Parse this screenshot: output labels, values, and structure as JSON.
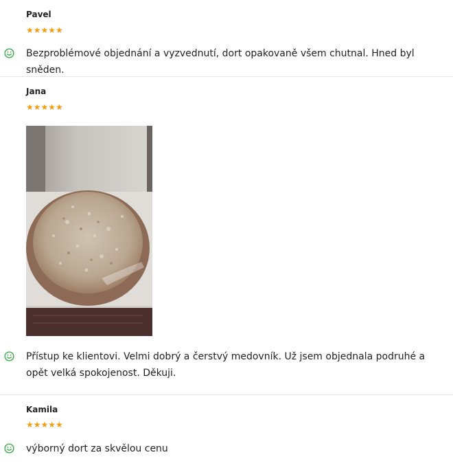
{
  "reviews": [
    {
      "name": "Pavel",
      "rating": 5,
      "stars": "★★★★★",
      "text": "Bezproblémové objednání a vyzvednutí, dort opakovaně všem chutnal. Hned byl sněden."
    },
    {
      "name": "Jana",
      "rating": 5,
      "stars": "★★★★★",
      "text": "Přístup ke klientovi. Velmi dobrý a čerstvý medovník. Už jsem objednala podruhé a opět velká spokojenost. Děkuji."
    },
    {
      "name": "Kamila",
      "rating": 5,
      "stars": "★★★★★",
      "text": "výborný dort za skvělou cenu"
    }
  ],
  "colors": {
    "star": "#f39c12",
    "positive_icon": "#2eaa3c",
    "divider": "#e6e6e6"
  },
  "icons": {
    "positive": "smiley-icon",
    "rating": "star-icon"
  }
}
